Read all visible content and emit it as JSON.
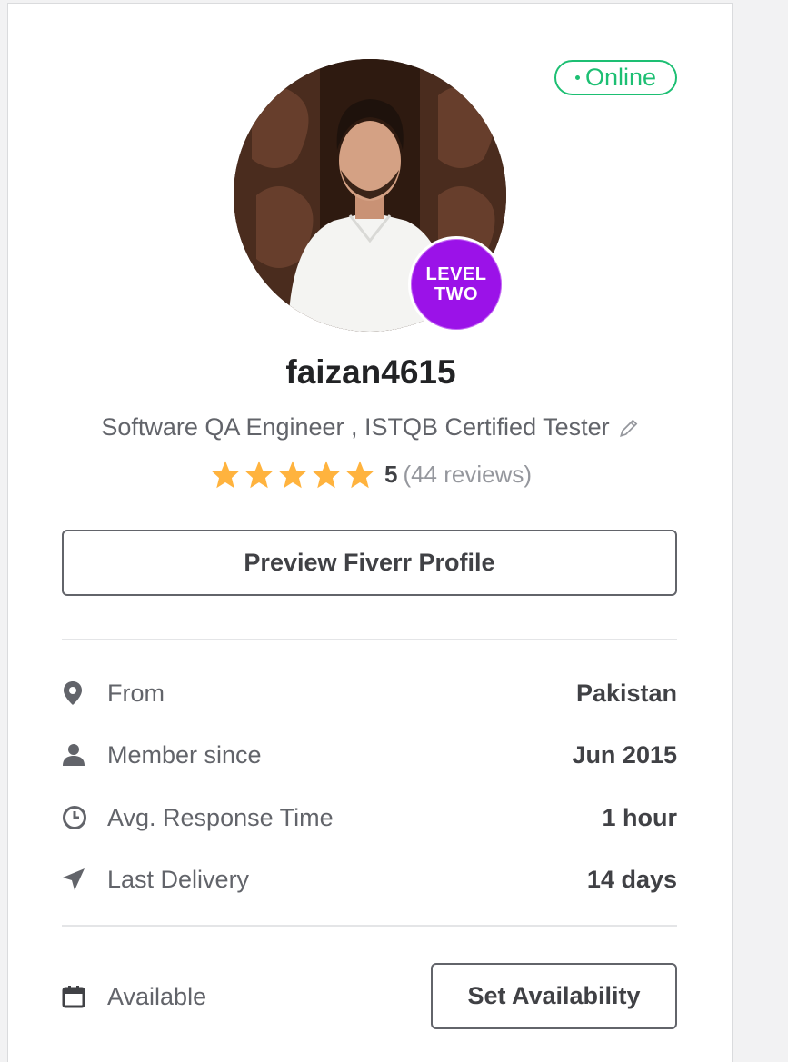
{
  "status": {
    "online_label": "Online",
    "color": "#1dbf73"
  },
  "profile": {
    "level_line1": "LEVEL",
    "level_line2": "TWO",
    "username": "faizan4615",
    "tagline": "Software QA Engineer , ISTQB Certified Tester",
    "rating_stars": 5,
    "rating_score": "5",
    "reviews": "(44 reviews)"
  },
  "actions": {
    "preview_label": "Preview Fiverr Profile",
    "availability_label": "Set Availability"
  },
  "info": [
    {
      "icon": "location-pin-icon",
      "label": "From",
      "value": "Pakistan"
    },
    {
      "icon": "user-icon",
      "label": "Member since",
      "value": "Jun 2015"
    },
    {
      "icon": "clock-icon",
      "label": "Avg. Response Time",
      "value": "1 hour"
    },
    {
      "icon": "send-icon",
      "label": "Last Delivery",
      "value": "14 days"
    }
  ],
  "availability": {
    "icon": "calendar-icon",
    "label": "Available"
  },
  "colors": {
    "accent_purple": "#9b12e8",
    "star": "#ffb33e",
    "text": "#404145"
  }
}
